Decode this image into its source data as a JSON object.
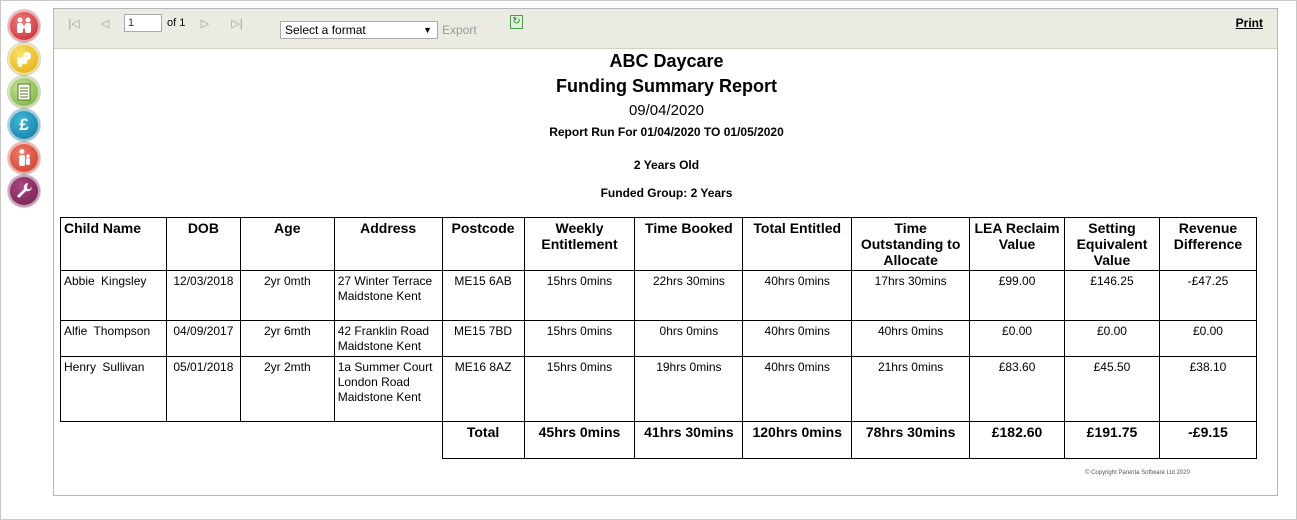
{
  "rail": {
    "icons": [
      "people-icon",
      "toy-icon",
      "notes-icon",
      "pound-icon",
      "staff-icon",
      "wrench-icon"
    ],
    "pound_glyph": "£"
  },
  "toolbar": {
    "page_value": "1",
    "page_of": "of 1",
    "format_placeholder": "Select a format",
    "export_label": "Export",
    "print_label": "Print"
  },
  "report": {
    "title": "ABC Daycare",
    "subtitle": "Funding Summary Report",
    "date": "09/04/2020",
    "run_for": "Report Run For 01/04/2020 TO 01/05/2020",
    "age_group": "2 Years Old",
    "funded_group": "Funded Group: 2 Years",
    "columns": [
      "Child Name",
      "DOB",
      "Age",
      "Address",
      "Postcode",
      "Weekly Entitlement",
      "Time Booked",
      "Total Entitled",
      "Time Outstanding to Allocate",
      "LEA Reclaim Value",
      "Setting Equivalent Value",
      "Revenue Difference"
    ],
    "rows": [
      [
        "Abbie  Kingsley",
        "12/03/2018",
        "2yr 0mth",
        "27 Winter Terrace Maidstone Kent",
        "ME15 6AB",
        "15hrs 0mins",
        "22hrs 30mins",
        "40hrs 0mins",
        "17hrs 30mins",
        "£99.00",
        "£146.25",
        "-£47.25"
      ],
      [
        "Alfie  Thompson",
        "04/09/2017",
        "2yr 6mth",
        "42 Franklin Road Maidstone Kent",
        "ME15 7BD",
        "15hrs 0mins",
        "0hrs 0mins",
        "40hrs 0mins",
        "40hrs 0mins",
        "£0.00",
        "£0.00",
        "£0.00"
      ],
      [
        "Henry  Sullivan",
        "05/01/2018",
        "2yr 2mth",
        "1a Summer Court London Road  Maidstone Kent",
        "ME16 8AZ",
        "15hrs 0mins",
        "19hrs 0mins",
        "40hrs 0mins",
        "21hrs 0mins",
        "£83.60",
        "£45.50",
        "£38.10"
      ]
    ],
    "totals": {
      "label": "Total",
      "weekly": "45hrs 0mins",
      "booked": "41hrs 30mins",
      "entitled": "120hrs 0mins",
      "outstanding": "78hrs 30mins",
      "lea": "£182.60",
      "setting": "£191.75",
      "difference": "-£9.15"
    },
    "copyright": "© Copyright Parenta Software Ltd 2020"
  }
}
